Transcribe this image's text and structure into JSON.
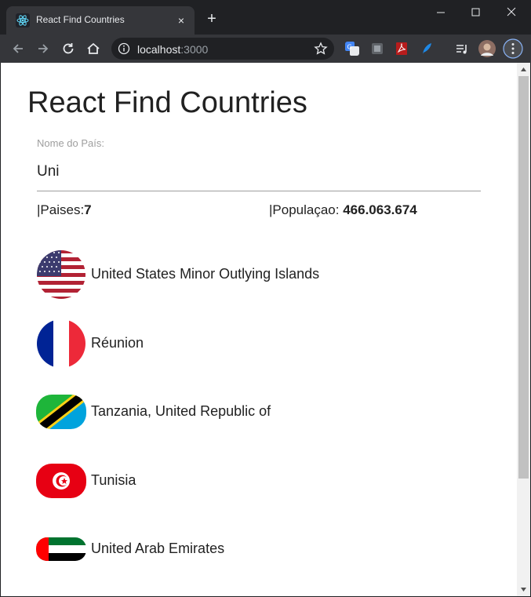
{
  "browser": {
    "tab_title": "React Find Countries",
    "tab_close": "×",
    "new_tab": "+",
    "url_host": "localhost",
    "url_port": ":3000"
  },
  "app": {
    "title": "React Find Countries",
    "search": {
      "label": "Nome do País:",
      "value": "Uni"
    },
    "stats": {
      "countries_label": "|Paises:",
      "countries_value": "7",
      "population_label": "|Populaçao: ",
      "population_value": "466.063.674"
    },
    "countries": [
      {
        "name": "United States Minor Outlying Islands",
        "flag_icon": "us-flag-icon"
      },
      {
        "name": "Réunion",
        "flag_icon": "france-flag-icon"
      },
      {
        "name": "Tanzania, United Republic of",
        "flag_icon": "tanzania-flag-icon"
      },
      {
        "name": "Tunisia",
        "flag_icon": "tunisia-flag-icon"
      },
      {
        "name": "United Arab Emirates",
        "flag_icon": "uae-flag-icon"
      }
    ]
  },
  "colors": {
    "chrome_dark": "#202124",
    "chrome_toolbar": "#35363a",
    "page_bg": "#ffffff",
    "label_gray": "#9e9e9e"
  }
}
